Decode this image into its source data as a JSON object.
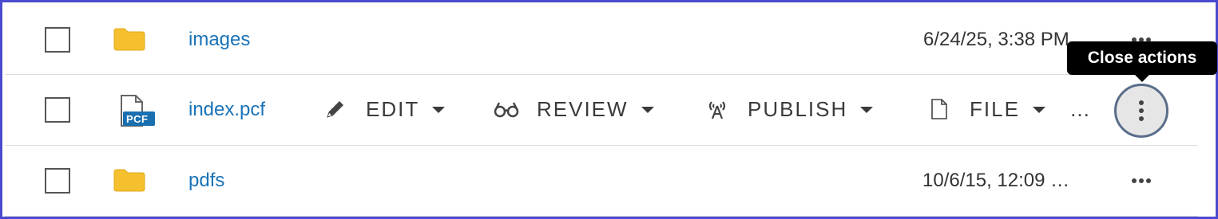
{
  "rows": [
    {
      "name": "images",
      "type_icon": "folder-icon",
      "date": "6/24/25, 3:38 PM",
      "checked": false
    },
    {
      "name": "index.pcf",
      "type_icon": "pcf-file-icon",
      "badge": "PCF",
      "checked": false
    },
    {
      "name": "pdfs",
      "type_icon": "folder-icon",
      "date": "10/6/15, 12:09 …",
      "checked": false
    }
  ],
  "actions": {
    "edit": {
      "label": "EDIT",
      "icon": "pencil-icon"
    },
    "review": {
      "label": "REVIEW",
      "icon": "glasses-icon"
    },
    "publish": {
      "label": "PUBLISH",
      "icon": "broadcast-icon"
    },
    "file": {
      "label": "FILE",
      "icon": "file-icon"
    },
    "overflow": "…"
  },
  "tooltip": {
    "text": "Close actions"
  },
  "colors": {
    "link": "#1a73b8",
    "folder": "#f5c02e",
    "frame": "#4a4ad0",
    "pcf_badge": "#1a6fb0",
    "tooltip_bg": "#000000",
    "close_button_border": "#5a6e8a"
  }
}
